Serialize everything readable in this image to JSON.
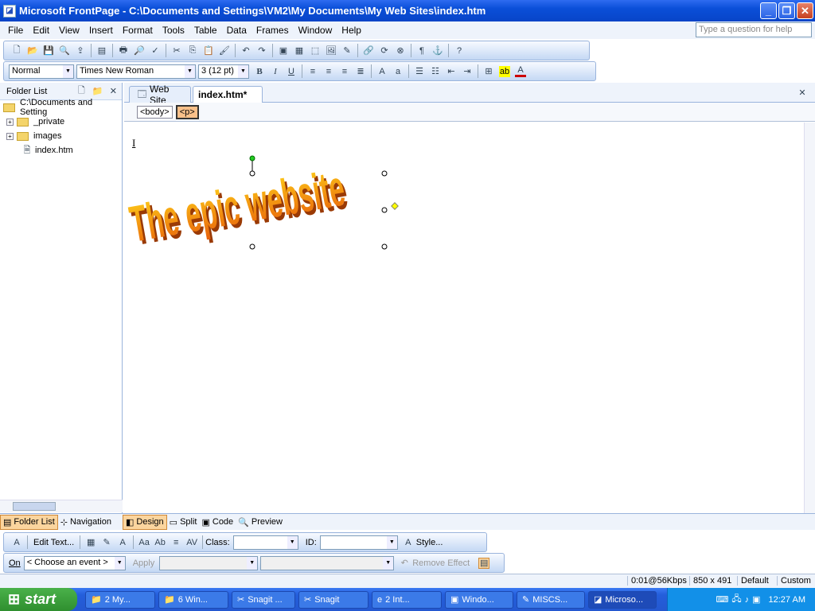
{
  "window": {
    "title": "Microsoft FrontPage - C:\\Documents and Settings\\VM2\\My Documents\\My Web Sites\\index.htm"
  },
  "menu": [
    "File",
    "Edit",
    "View",
    "Insert",
    "Format",
    "Tools",
    "Table",
    "Data",
    "Frames",
    "Window",
    "Help"
  ],
  "help_placeholder": "Type a question for help",
  "format_toolbar": {
    "style": "Normal",
    "font": "Times New Roman",
    "size": "3  (12 pt)"
  },
  "folder_list": {
    "title": "Folder List",
    "root": "C:\\Documents and Setting",
    "items": [
      "_private",
      "images",
      "index.htm"
    ]
  },
  "tabs": {
    "web_site": "Web Site",
    "doc": "index.htm*"
  },
  "tags": [
    "<body>",
    "<p>"
  ],
  "wordart": {
    "text": "The epic website",
    "colors": {
      "top": "#ffd21a",
      "bottom": "#e8600a"
    }
  },
  "view_tabs": [
    "Design",
    "Split",
    "Code",
    "Preview"
  ],
  "left_tabs": [
    "Folder List",
    "Navigation"
  ],
  "toolbar3": {
    "edit_text": "Edit Text...",
    "class_label": "Class:",
    "id_label": "ID:",
    "style": "Style..."
  },
  "toolbar4": {
    "on": "On",
    "event": "< Choose an event >",
    "apply": "Apply",
    "remove_effect": "Remove Effect"
  },
  "status": {
    "speed": "0:01@56Kbps",
    "size": "850 x 491",
    "mode1": "Default",
    "mode2": "Custom"
  },
  "taskbar": {
    "start": "start",
    "tasks": [
      "2 My...",
      "6 Win...",
      "Snagit ...",
      "Snagit",
      "2 Int...",
      "Windo...",
      "MISCS...",
      "Microso..."
    ],
    "clock": "12:27 AM"
  }
}
